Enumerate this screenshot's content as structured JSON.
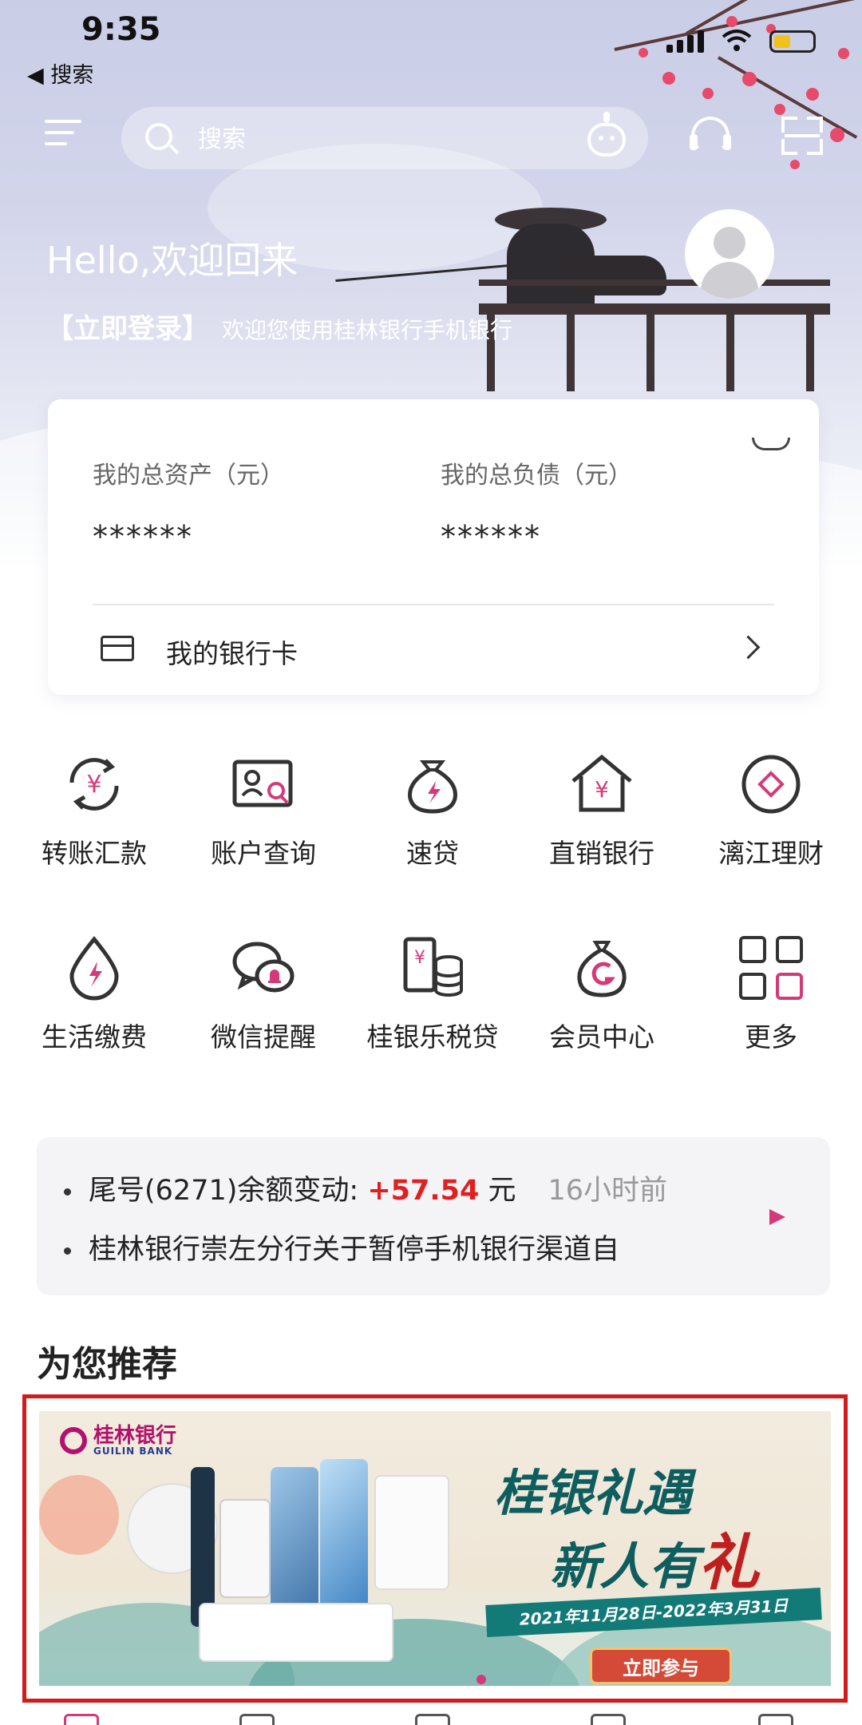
{
  "status_bar": {
    "time": "9:35",
    "back_label": "◀ 搜索"
  },
  "header": {
    "search_placeholder": "搜索"
  },
  "welcome": {
    "greeting": "Hello,欢迎回来",
    "login": "【立即登录】",
    "subtitle": "欢迎您使用桂林银行手机银行"
  },
  "assets": {
    "total_assets_label": "我的总资产（元）",
    "total_assets_value": "******",
    "total_liabilities_label": "我的总负债（元）",
    "total_liabilities_value": "******",
    "bank_card_label": "我的银行卡"
  },
  "quick_menu": [
    {
      "label": "转账汇款",
      "icon": "transfer-icon"
    },
    {
      "label": "账户查询",
      "icon": "account-query-icon"
    },
    {
      "label": "速贷",
      "icon": "quick-loan-icon"
    },
    {
      "label": "直销银行",
      "icon": "direct-bank-icon"
    },
    {
      "label": "漓江理财",
      "icon": "wealth-icon"
    },
    {
      "label": "生活缴费",
      "icon": "bill-pay-icon"
    },
    {
      "label": "微信提醒",
      "icon": "wechat-alert-icon"
    },
    {
      "label": "桂银乐税贷",
      "icon": "tax-loan-icon"
    },
    {
      "label": "会员中心",
      "icon": "member-icon"
    },
    {
      "label": "更多",
      "icon": "more-grid-icon"
    }
  ],
  "notice": {
    "line1_prefix": "尾号(6271)余额变动: ",
    "line1_amount": "+57.54",
    "line1_unit": " 元",
    "line1_time": "16小时前",
    "line2": "桂林银行崇左分行关于暂停手机银行渠道自"
  },
  "recommend": {
    "title": "为您推荐",
    "banner": {
      "logo_cn": "桂林银行",
      "logo_en": "GUILIN BANK",
      "slogan_line1": "桂银礼遇",
      "slogan_line2_a": "新人有",
      "slogan_line2_b": "礼",
      "date_range": "2021年11月28日-2022年3月31日",
      "cta": "立即参与"
    }
  },
  "colors": {
    "accent": "#d43a7a",
    "amount": "#e02020",
    "highlight_border": "#d21b1b"
  }
}
